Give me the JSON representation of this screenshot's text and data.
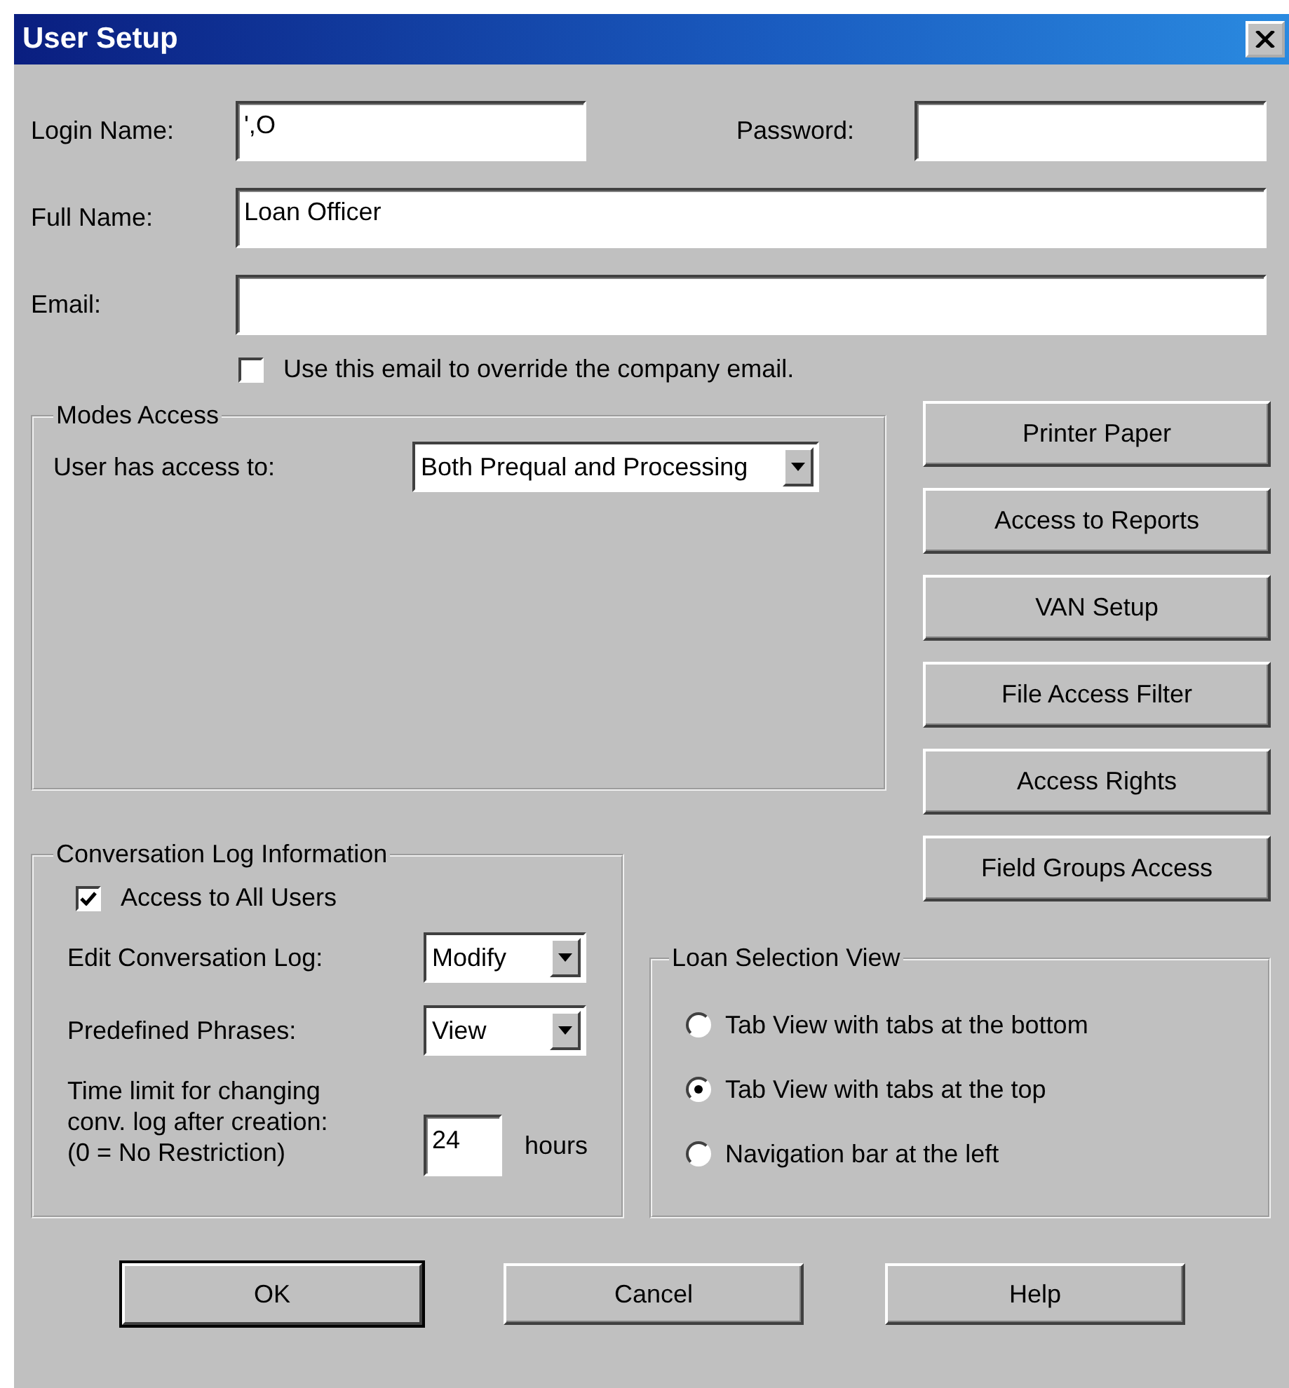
{
  "window": {
    "title": "User Setup"
  },
  "login": {
    "label": "Login Name:",
    "value": "',O"
  },
  "password": {
    "label": "Password:"
  },
  "full_name": {
    "label": "Full Name:",
    "value": "Loan Officer"
  },
  "email": {
    "label": "Email:"
  },
  "override_email": {
    "label": "Use this email to override the company email.",
    "checked": false
  },
  "modes_access": {
    "title": "Modes Access",
    "label": "User has access to:",
    "value": "Both Prequal and Processing"
  },
  "side_buttons": [
    {
      "label": "Printer Paper"
    },
    {
      "label": "Access to Reports"
    },
    {
      "label": "VAN Setup"
    },
    {
      "label": "File Access Filter"
    },
    {
      "label": "Access Rights"
    },
    {
      "label": "Field Groups Access"
    }
  ],
  "conversation_log": {
    "title": "Conversation Log Information",
    "access_all": {
      "label": "Access to All Users",
      "checked": true
    },
    "dropdowns": [
      {
        "label": "Edit Conversation Log:",
        "value": "Modify"
      },
      {
        "label": "Predefined Phrases:",
        "value": "View"
      }
    ],
    "time_limit": {
      "lines": [
        "Time limit for changing",
        "conv. log after creation:",
        "(0 = No Restriction)"
      ],
      "value": "24",
      "unit": "hours"
    }
  },
  "loan_selection_view": {
    "title": "Loan Selection View",
    "options": [
      {
        "label": "Tab View with tabs at the bottom",
        "selected": false
      },
      {
        "label": "Tab View with tabs at the top",
        "selected": true
      },
      {
        "label": "Navigation bar at the left",
        "selected": false
      }
    ]
  },
  "buttons": [
    {
      "label": "OK",
      "default": true
    },
    {
      "label": "Cancel",
      "default": false
    },
    {
      "label": "Help",
      "default": false
    }
  ]
}
